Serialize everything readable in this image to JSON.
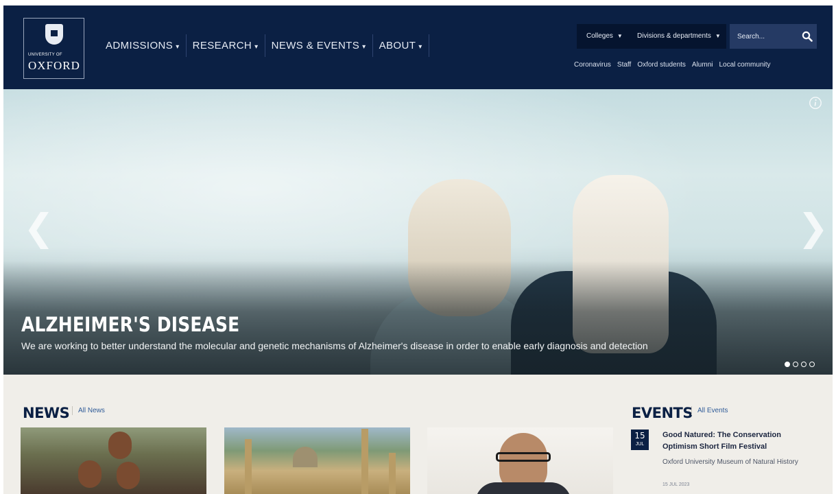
{
  "logo": {
    "line1": "UNIVERSITY OF",
    "line2": "OXFORD"
  },
  "main_nav": [
    {
      "label": "ADMISSIONS"
    },
    {
      "label": "RESEARCH"
    },
    {
      "label": "NEWS & EVENTS"
    },
    {
      "label": "ABOUT"
    }
  ],
  "dropdowns": {
    "colleges": "Colleges",
    "divisions": "Divisions & departments"
  },
  "search": {
    "placeholder": "Search..."
  },
  "utility_links": [
    "Coronavirus",
    "Staff",
    "Oxford students",
    "Alumni",
    "Local community"
  ],
  "hero": {
    "title": "ALZHEIMER'S DISEASE",
    "subtitle": "We are working to better understand the molecular and genetic mechanisms of Alzheimer's disease in order to enable early diagnosis and detection",
    "slide_count": 4,
    "active_slide": 1
  },
  "news": {
    "title": "NEWS",
    "link": "All News"
  },
  "events": {
    "title": "EVENTS",
    "link": "All Events",
    "items": [
      {
        "day": "15",
        "month": "JUL",
        "title": "Good Natured: The Conservation Optimism Short Film Festival",
        "venue": "Oxford University Museum of Natural History",
        "date": "15 JUL 2023"
      }
    ]
  },
  "colors": {
    "brand_navy": "#0b2044",
    "link_blue": "#2e5a97",
    "lower_bg": "#f0eee9"
  }
}
